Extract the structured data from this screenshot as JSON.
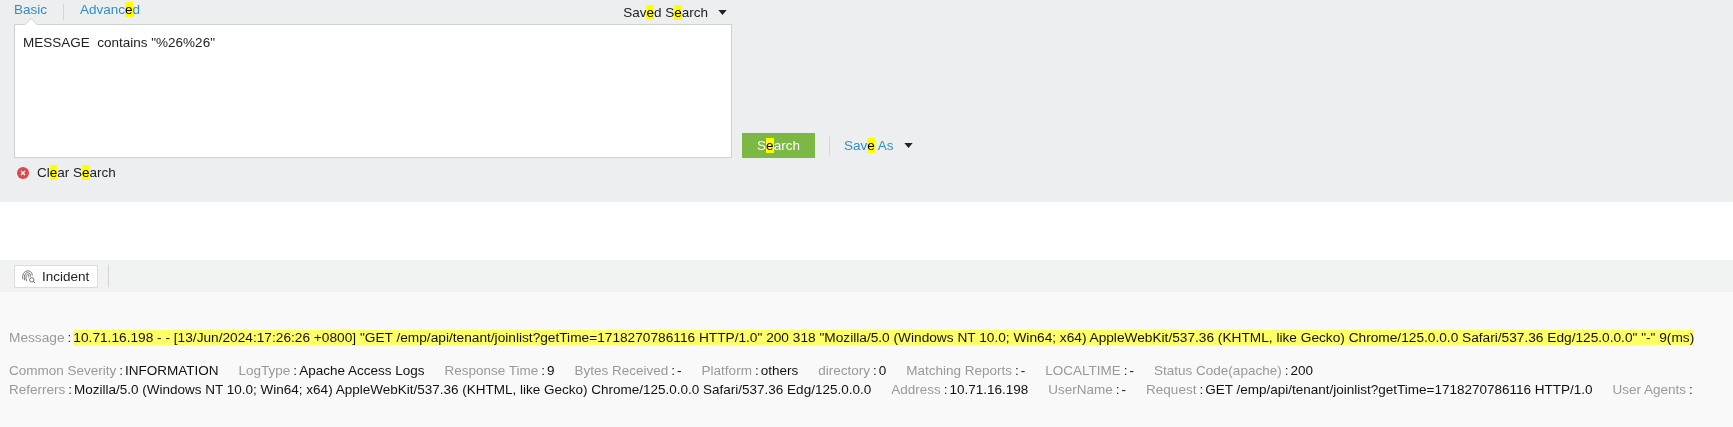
{
  "search_panel": {
    "tabs": [
      {
        "label": [
          {
            "text": "Basic",
            "highlight": false
          }
        ],
        "selected": true
      },
      {
        "label": [
          {
            "text": "Advanc",
            "highlight": false
          },
          {
            "text": "e",
            "highlight": true
          },
          {
            "text": "d",
            "highlight": false
          }
        ],
        "selected": false
      }
    ],
    "saved_search": {
      "label": [
        {
          "text": "Sav",
          "highlight": false
        },
        {
          "text": "e",
          "highlight": true
        },
        {
          "text": "d S",
          "highlight": false
        },
        {
          "text": "e",
          "highlight": true
        },
        {
          "text": "arch",
          "highlight": false
        }
      ]
    },
    "query": {
      "value": "MESSAGE  contains \"%26%26\""
    },
    "search_button": {
      "label": [
        {
          "text": "S",
          "highlight": false
        },
        {
          "text": "e",
          "highlight": true
        },
        {
          "text": "arch",
          "highlight": false
        }
      ]
    },
    "save_as": {
      "label": [
        {
          "text": "Sav",
          "highlight": false
        },
        {
          "text": "e",
          "highlight": true
        },
        {
          "text": " As",
          "highlight": false
        }
      ]
    },
    "clear_search": {
      "label": [
        {
          "text": "Cl",
          "highlight": false
        },
        {
          "text": "e",
          "highlight": true
        },
        {
          "text": "ar S",
          "highlight": false
        },
        {
          "text": "e",
          "highlight": true
        },
        {
          "text": "arch",
          "highlight": false
        }
      ]
    }
  },
  "toolbar": {
    "buttons": [
      {
        "label": "Incident"
      }
    ]
  },
  "details": {
    "message": {
      "label": "Message",
      "colon": ":",
      "value": "10.71.16.198 - - [13/Jun/2024:17:26:26 +0800] \"GET /emp/api/tenant/joinlist?getTime=1718270786116 HTTP/1.0\" 200 318 \"Mozilla/5.0 (Windows NT 10.0; Win64; x64) AppleWebKit/537.36 (KHTML, like Gecko) Chrome/125.0.0.0 Safari/537.36 Edg/125.0.0.0\" \"-\" 9(ms)",
      "highlighted": true
    },
    "fields": [
      {
        "label": "Common Severity",
        "colon": ":",
        "value": "INFORMATION"
      },
      {
        "label": "LogType",
        "colon": ":",
        "value": "Apache Access Logs"
      },
      {
        "label": "Response Time",
        "colon": ":",
        "value": "9"
      },
      {
        "label": "Bytes Received",
        "colon": ":",
        "value": "-"
      },
      {
        "label": "Platform",
        "colon": ":",
        "value": "others"
      },
      {
        "label": "directory",
        "colon": ":",
        "value": "0"
      },
      {
        "label": "Matching Reports",
        "colon": ":",
        "value": "-"
      },
      {
        "label": "LOCALTIME",
        "colon": ":",
        "value": "-"
      },
      {
        "label": "Status Code(apache)",
        "colon": ":",
        "value": "200"
      },
      {
        "label": "Referrers",
        "colon": ":",
        "value": "Mozilla/5.0 (Windows NT 10.0; Win64; x64) AppleWebKit/537.36 (KHTML, like Gecko) Chrome/125.0.0.0 Safari/537.36 Edg/125.0.0.0"
      },
      {
        "label": "Address",
        "colon": ":",
        "value": "10.71.16.198"
      },
      {
        "label": "UserName",
        "colon": ":",
        "value": "-"
      },
      {
        "label": "Request",
        "colon": ":",
        "value": "GET /emp/api/tenant/joinlist?getTime=1718270786116 HTTP/1.0"
      },
      {
        "label": "User Agents",
        "colon": ":"
      }
    ]
  }
}
